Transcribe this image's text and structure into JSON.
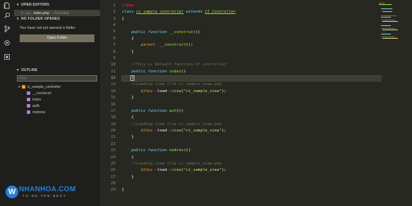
{
  "activity_bar": {
    "icons": [
      "files-icon",
      "search-icon",
      "source-control-icon",
      "debug-icon",
      "extensions-icon"
    ]
  },
  "sidebar": {
    "open_editors": {
      "header": "OPEN EDITORS",
      "file": {
        "close": "×",
        "badge": "php",
        "name": "index.php",
        "path": "~/Desktop"
      }
    },
    "no_folder": {
      "header": "NO FOLDER OPENED",
      "message": "You have not yet opened a folder.",
      "button": "Open Folder"
    },
    "outline": {
      "header": "OUTLINE",
      "filter_placeholder": "Filter",
      "class_name": "ci_sample_controller",
      "members": [
        "__construct",
        "index",
        "auth",
        "nodress"
      ]
    }
  },
  "editor": {
    "active_line": 12,
    "line_numbers": [
      "1",
      "2",
      "3",
      "4",
      "5",
      "6",
      "7",
      "8",
      "9",
      "10",
      "11",
      "12",
      "13",
      "14",
      "15",
      "16",
      "17",
      "18",
      "19",
      "20",
      "21",
      "22",
      "23",
      "24",
      "25",
      "26",
      "27",
      "28",
      "29"
    ]
  },
  "watermark": {
    "letter": "W",
    "name": "NHANHOA.COM",
    "tagline": "TO BE THE BEST"
  },
  "colors": {
    "keyword": "#f92672",
    "string": "#e6db74",
    "function": "#a6e22e",
    "storage": "#66d9ef",
    "comment": "#75715e",
    "background": "#272822"
  }
}
